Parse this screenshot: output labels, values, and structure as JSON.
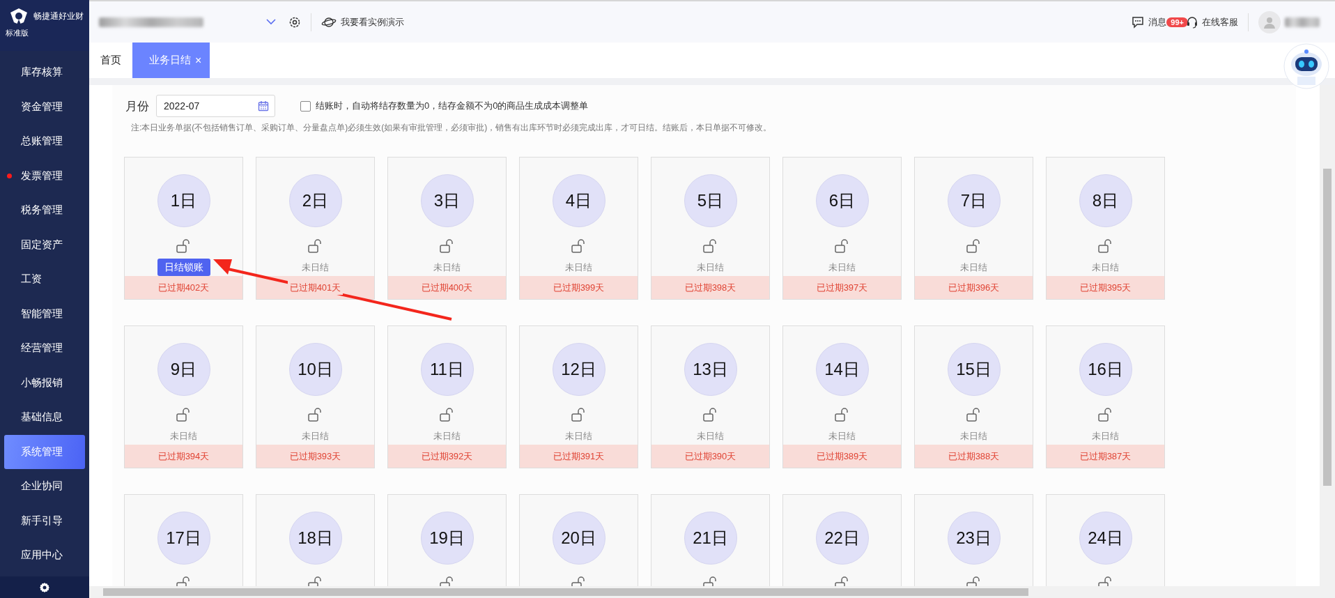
{
  "brand": {
    "name": "畅捷通好业财",
    "edition": "标准版"
  },
  "header": {
    "demo_link": "我要看实例演示",
    "messages": {
      "label": "消息",
      "badge": "99+"
    },
    "support": "在线客服"
  },
  "sidebar": {
    "items": [
      {
        "label": "库存核算",
        "selected": false,
        "alert": false
      },
      {
        "label": "资金管理",
        "selected": false,
        "alert": false
      },
      {
        "label": "总账管理",
        "selected": false,
        "alert": false
      },
      {
        "label": "发票管理",
        "selected": false,
        "alert": true
      },
      {
        "label": "税务管理",
        "selected": false,
        "alert": false
      },
      {
        "label": "固定资产",
        "selected": false,
        "alert": false
      },
      {
        "label": "工资",
        "selected": false,
        "alert": false
      },
      {
        "label": "智能管理",
        "selected": false,
        "alert": false
      },
      {
        "label": "经营管理",
        "selected": false,
        "alert": false
      },
      {
        "label": "小畅报销",
        "selected": false,
        "alert": false
      },
      {
        "label": "基础信息",
        "selected": false,
        "alert": false
      },
      {
        "label": "系统管理",
        "selected": true,
        "alert": false
      },
      {
        "label": "企业协同",
        "selected": false,
        "alert": false
      },
      {
        "label": "新手引导",
        "selected": false,
        "alert": false
      },
      {
        "label": "应用中心",
        "selected": false,
        "alert": false
      }
    ]
  },
  "tabs": [
    {
      "label": "首页",
      "selected": false,
      "closable": false
    },
    {
      "label": "业务日结",
      "selected": true,
      "closable": true,
      "close": "×"
    }
  ],
  "filter": {
    "label": "月份",
    "month": "2022-07",
    "option": {
      "label": "结账时，自动将结存数量为0，结存金额不为0的商品生成成本调整单",
      "checked": false
    }
  },
  "note": "注:本日业务单据(不包括销售订单、采购订单、分量盘点单)必须生效(如果有审批管理，必须审批)，销售有出库环节时必须完成出库，才可日结。结账后，本日单据不可修改。",
  "days": [
    {
      "day": "1日",
      "kind": "lock_button",
      "status": "日结锁账",
      "overdue": "已过期402天"
    },
    {
      "day": "2日",
      "kind": "pending",
      "status": "未日结",
      "overdue": "已过期401天"
    },
    {
      "day": "3日",
      "kind": "pending",
      "status": "未日结",
      "overdue": "已过期400天"
    },
    {
      "day": "4日",
      "kind": "pending",
      "status": "未日结",
      "overdue": "已过期399天"
    },
    {
      "day": "5日",
      "kind": "pending",
      "status": "未日结",
      "overdue": "已过期398天"
    },
    {
      "day": "6日",
      "kind": "pending",
      "status": "未日结",
      "overdue": "已过期397天"
    },
    {
      "day": "7日",
      "kind": "pending",
      "status": "未日结",
      "overdue": "已过期396天"
    },
    {
      "day": "8日",
      "kind": "pending",
      "status": "未日结",
      "overdue": "已过期395天"
    },
    {
      "day": "9日",
      "kind": "pending",
      "status": "未日结",
      "overdue": "已过期394天"
    },
    {
      "day": "10日",
      "kind": "pending",
      "status": "未日结",
      "overdue": "已过期393天"
    },
    {
      "day": "11日",
      "kind": "pending",
      "status": "未日结",
      "overdue": "已过期392天"
    },
    {
      "day": "12日",
      "kind": "pending",
      "status": "未日结",
      "overdue": "已过期391天"
    },
    {
      "day": "13日",
      "kind": "pending",
      "status": "未日结",
      "overdue": "已过期390天"
    },
    {
      "day": "14日",
      "kind": "pending",
      "status": "未日结",
      "overdue": "已过期389天"
    },
    {
      "day": "15日",
      "kind": "pending",
      "status": "未日结",
      "overdue": "已过期388天"
    },
    {
      "day": "16日",
      "kind": "pending",
      "status": "未日结",
      "overdue": "已过期387天"
    },
    {
      "day": "17日",
      "kind": "pending"
    },
    {
      "day": "18日",
      "kind": "pending"
    },
    {
      "day": "19日",
      "kind": "pending"
    },
    {
      "day": "20日",
      "kind": "pending"
    },
    {
      "day": "21日",
      "kind": "pending"
    },
    {
      "day": "22日",
      "kind": "pending"
    },
    {
      "day": "23日",
      "kind": "pending"
    },
    {
      "day": "24日",
      "kind": "pending"
    }
  ]
}
